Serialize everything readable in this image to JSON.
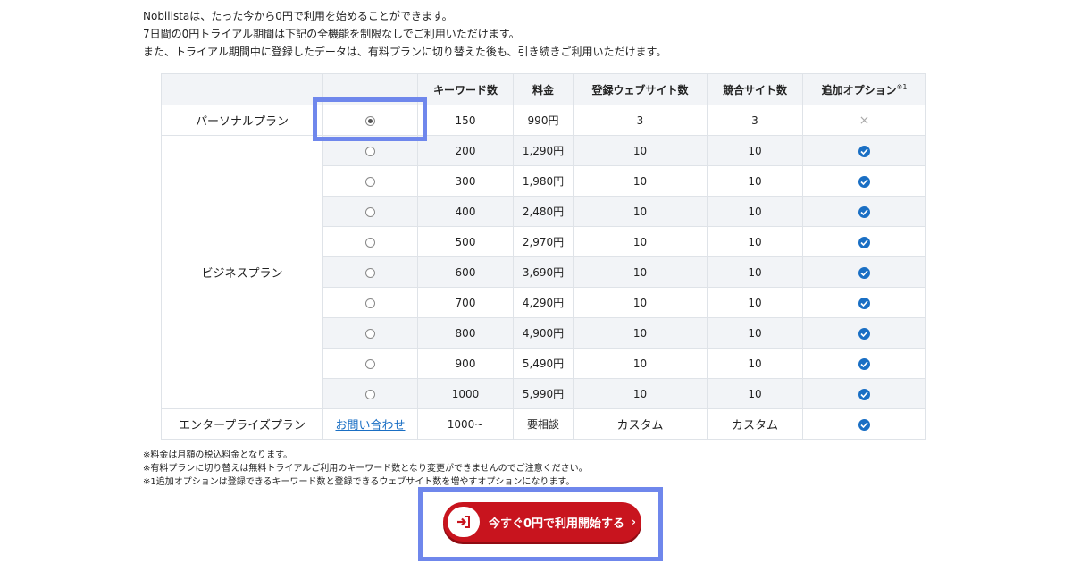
{
  "intro": {
    "line1": "Nobilistaは、たった今から0円で利用を始めることができます。",
    "line2": "7日間の0円トライアル期間は下記の全機能を制限なしでご利用いただけます。",
    "line3": "また、トライアル期間中に登録したデータは、有料プランに切り替えた後も、引き続きご利用いただけます。"
  },
  "table": {
    "headers": {
      "plan": "",
      "select": "",
      "keywords": "キーワード数",
      "price": "料金",
      "sites": "登録ウェブサイト数",
      "competitors": "競合サイト数",
      "option": "追加オプション",
      "option_note": "※1"
    },
    "personal": {
      "name": "パーソナルプラン",
      "keywords": "150",
      "price": "990円",
      "sites": "3",
      "competitors": "3",
      "option": "×"
    },
    "business": {
      "name": "ビジネスプラン",
      "rows": [
        {
          "keywords": "200",
          "price": "1,290円",
          "sites": "10",
          "competitors": "10"
        },
        {
          "keywords": "300",
          "price": "1,980円",
          "sites": "10",
          "competitors": "10"
        },
        {
          "keywords": "400",
          "price": "2,480円",
          "sites": "10",
          "competitors": "10"
        },
        {
          "keywords": "500",
          "price": "2,970円",
          "sites": "10",
          "competitors": "10"
        },
        {
          "keywords": "600",
          "price": "3,690円",
          "sites": "10",
          "competitors": "10"
        },
        {
          "keywords": "700",
          "price": "4,290円",
          "sites": "10",
          "competitors": "10"
        },
        {
          "keywords": "800",
          "price": "4,900円",
          "sites": "10",
          "competitors": "10"
        },
        {
          "keywords": "900",
          "price": "5,490円",
          "sites": "10",
          "competitors": "10"
        },
        {
          "keywords": "1000",
          "price": "5,990円",
          "sites": "10",
          "competitors": "10"
        }
      ]
    },
    "enterprise": {
      "name": "エンタープライズプラン",
      "contact": "お問い合わせ",
      "keywords": "1000~",
      "price": "要相談",
      "sites": "カスタム",
      "competitors": "カスタム"
    }
  },
  "notes": {
    "n1": "※料金は月額の税込料金となります。",
    "n2": "※有料プランに切り替えは無料トライアルご利用のキーワード数となり変更ができませんのでご注意ください。",
    "n3": "※1追加オプションは登録できるキーワード数と登録できるウェブサイト数を増やすオプションになります。"
  },
  "cta": {
    "label": "今すぐ0円で利用開始する",
    "chevron": "›"
  },
  "colors": {
    "accent_blue": "#1a6fc4",
    "cta_red": "#c8141e",
    "highlight": "#6f87ec",
    "row_alt": "#f2f4f7"
  },
  "icons": [
    "radio-icon",
    "check-icon",
    "cross-icon",
    "login-icon",
    "chevron-right-icon"
  ]
}
